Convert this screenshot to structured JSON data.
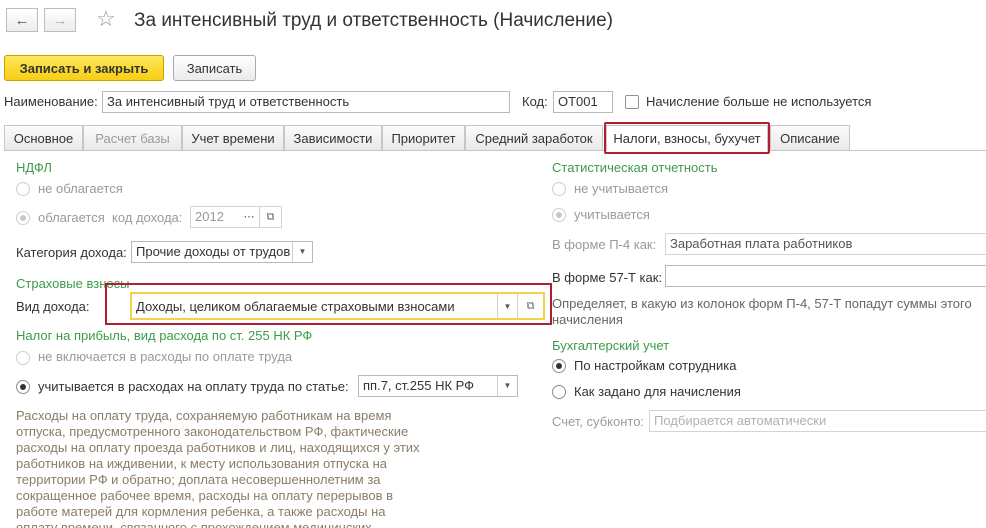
{
  "header": {
    "back_icon": "arrow-left-icon",
    "forward_icon": "arrow-right-icon",
    "favorite_icon": "star-icon",
    "title": "За интенсивный труд и ответственность (Начисление)"
  },
  "toolbar": {
    "save_close_label": "Записать и закрыть",
    "save_label": "Записать"
  },
  "form": {
    "name_label": "Наименование:",
    "name_value": "За интенсивный труд и ответственность",
    "code_label": "Код:",
    "code_value": "ОТ001",
    "unused_label": "Начисление больше не используется"
  },
  "tabs": [
    {
      "label": "Основное"
    },
    {
      "label": "Расчет базы"
    },
    {
      "label": "Учет времени"
    },
    {
      "label": "Зависимости"
    },
    {
      "label": "Приоритет"
    },
    {
      "label": "Средний заработок"
    },
    {
      "label": "Налоги, взносы, бухучет"
    },
    {
      "label": "Описание"
    }
  ],
  "ndfl": {
    "heading": "НДФЛ",
    "not_taxed_label": "не облагается",
    "taxed_label": "облагается",
    "income_code_label": "код дохода:",
    "income_code_value": "2012",
    "category_label": "Категория дохода:",
    "category_value": "Прочие доходы от трудов"
  },
  "insurance": {
    "heading": "Страховые взносы",
    "income_type_label": "Вид дохода:",
    "income_type_value": "Доходы, целиком облагаемые страховыми взносами"
  },
  "profit_tax": {
    "heading": "Налог на прибыль, вид расхода по ст. 255 НК РФ",
    "not_included_label": "не включается в расходы по оплате труда",
    "included_label": "учитывается в расходах на оплату труда по статье:",
    "article_value": "пп.7, ст.255 НК РФ",
    "description": "Расходы на оплату труда, сохраняемую работникам на время отпуска, предусмотренного законодательством РФ, фактические расходы на оплату проезда работников и лиц, находящихся у этих работников на иждивении, к месту использования отпуска на территории РФ и обратно; доплата несовершеннолетним за сокращенное рабочее время, расходы на оплату перерывов в работе матерей для кормления ребенка, а также расходы на оплату времени, связанного с прохождением медицинских"
  },
  "stats": {
    "heading": "Статистическая отчетность",
    "not_counted_label": "не учитывается",
    "counted_label": "учитывается",
    "p4_label": "В форме П-4 как:",
    "p4_value": "Заработная плата работников",
    "f57_label": "В форме 57-Т как:",
    "f57_value": "",
    "hint": "Определяет, в какую из колонок форм П-4, 57-Т попадут суммы этого начисления"
  },
  "accounting": {
    "heading": "Бухгалтерский учет",
    "by_employee_label": "По настройкам сотрудника",
    "as_set_label": "Как задано для начисления",
    "account_label": "Счет, субконто:",
    "account_placeholder": "Подбирается автоматически"
  },
  "colors": {
    "accent_yellow": "#f7cf15",
    "section_green": "#3d9b49",
    "highlight_red": "#b21e2f"
  }
}
